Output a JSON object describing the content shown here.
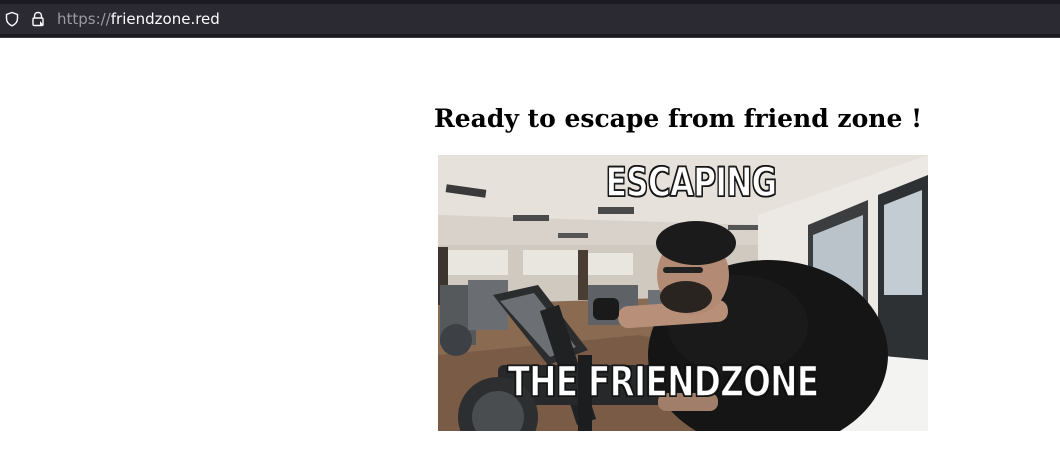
{
  "browser": {
    "url_scheme": "https://",
    "url_host": "friendzone.red",
    "icons": [
      "shield-icon",
      "lock-icon"
    ]
  },
  "page": {
    "heading": "Ready to escape from friend zone !",
    "image": {
      "caption_top": "ESCAPING",
      "caption_bottom": "THE FRIENDZONE"
    }
  },
  "colors": {
    "toolbar_bg": "#1c1b22",
    "url_field_bg": "#2b2a33",
    "page_bg": "#ffffff",
    "heading_text": "#000000"
  }
}
